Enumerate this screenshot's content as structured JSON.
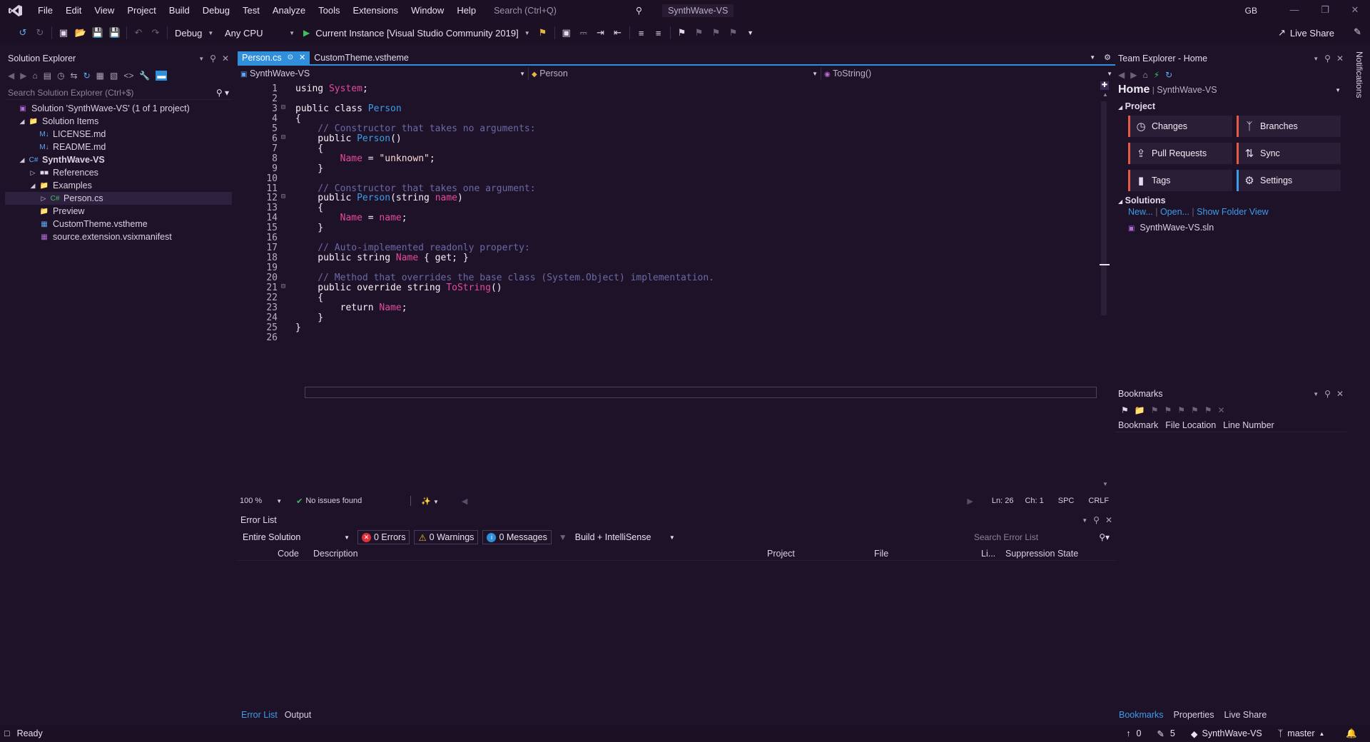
{
  "colors": {
    "background": "#1e1228",
    "accent": "#2f8fdb",
    "keyword": "#f4f1f8",
    "type": "#3d9ce8",
    "comment": "#6a6aa6",
    "identifier": "#e44a9e",
    "string": "#fbdcd8",
    "orange_bar": "#e35a45",
    "blue_bar": "#3d9ce8"
  },
  "menu": [
    "File",
    "Edit",
    "View",
    "Project",
    "Build",
    "Debug",
    "Test",
    "Analyze",
    "Tools",
    "Extensions",
    "Window",
    "Help"
  ],
  "search": {
    "placeholder": "Search (Ctrl+Q)"
  },
  "title": {
    "solution_name": "SynthWave-VS",
    "user_initials": "GB"
  },
  "toolbar": {
    "configuration": "Debug",
    "platform": "Any CPU",
    "run_label": "Current Instance [Visual Studio Community 2019]",
    "live_share": "Live Share"
  },
  "solution_explorer": {
    "title": "Solution Explorer",
    "search_placeholder": "Search Solution Explorer (Ctrl+$)",
    "tree": [
      {
        "label": "Solution 'SynthWave-VS' (1 of 1 project)",
        "icon": "solution-icon",
        "level": 0,
        "twisty": ""
      },
      {
        "label": "Solution Items",
        "icon": "folder-icon",
        "level": 1,
        "twisty": "open"
      },
      {
        "label": "LICENSE.md",
        "icon": "markdown-icon",
        "level": 2,
        "twisty": ""
      },
      {
        "label": "README.md",
        "icon": "markdown-icon",
        "level": 2,
        "twisty": ""
      },
      {
        "label": "SynthWave-VS",
        "icon": "csharp-project-icon",
        "level": 1,
        "twisty": "open",
        "bold": true
      },
      {
        "label": "References",
        "icon": "references-icon",
        "level": 2,
        "twisty": "closed"
      },
      {
        "label": "Examples",
        "icon": "folder-icon",
        "level": 2,
        "twisty": "open"
      },
      {
        "label": "Person.cs",
        "icon": "csharp-file-icon",
        "level": 3,
        "twisty": "closed",
        "selected": true
      },
      {
        "label": "Preview",
        "icon": "folder-icon",
        "level": 2,
        "twisty": ""
      },
      {
        "label": "CustomTheme.vstheme",
        "icon": "vstheme-file-icon",
        "level": 2,
        "twisty": ""
      },
      {
        "label": "source.extension.vsixmanifest",
        "icon": "manifest-file-icon",
        "level": 2,
        "twisty": ""
      }
    ]
  },
  "editor": {
    "tabs": [
      {
        "label": "Person.cs",
        "active": true
      },
      {
        "label": "CustomTheme.vstheme",
        "active": false
      }
    ],
    "nav": {
      "project": "SynthWave-VS",
      "type": "Person",
      "member": "ToString()"
    },
    "status": {
      "zoom": "100 %",
      "issues": "No issues found",
      "line": "Ln: 26",
      "col": "Ch: 1",
      "spacing": "SPC",
      "line_ending": "CRLF"
    }
  },
  "code_lines": [
    [
      {
        "t": "using ",
        "c": "kw"
      },
      {
        "t": "System",
        "c": "ident"
      },
      {
        "t": ";",
        "c": "kw"
      }
    ],
    [],
    [
      {
        "t": "public class ",
        "c": "kw"
      },
      {
        "t": "Person",
        "c": "type"
      }
    ],
    [
      {
        "t": "{",
        "c": "kw"
      }
    ],
    [
      {
        "t": "    // Constructor that takes no arguments:",
        "c": "cmt"
      }
    ],
    [
      {
        "t": "    public ",
        "c": "kw"
      },
      {
        "t": "Person",
        "c": "type"
      },
      {
        "t": "()",
        "c": "kw"
      }
    ],
    [
      {
        "t": "    {",
        "c": "kw"
      }
    ],
    [
      {
        "t": "        ",
        "c": "kw"
      },
      {
        "t": "Name",
        "c": "ident"
      },
      {
        "t": " = ",
        "c": "kw"
      },
      {
        "t": "\"unknown\"",
        "c": "str"
      },
      {
        "t": ";",
        "c": "kw"
      }
    ],
    [
      {
        "t": "    }",
        "c": "kw"
      }
    ],
    [],
    [
      {
        "t": "    // Constructor that takes one argument:",
        "c": "cmt"
      }
    ],
    [
      {
        "t": "    public ",
        "c": "kw"
      },
      {
        "t": "Person",
        "c": "type"
      },
      {
        "t": "(string ",
        "c": "kw"
      },
      {
        "t": "name",
        "c": "ident"
      },
      {
        "t": ")",
        "c": "kw"
      }
    ],
    [
      {
        "t": "    {",
        "c": "kw"
      }
    ],
    [
      {
        "t": "        ",
        "c": "kw"
      },
      {
        "t": "Name",
        "c": "ident"
      },
      {
        "t": " = ",
        "c": "kw"
      },
      {
        "t": "name",
        "c": "ident"
      },
      {
        "t": ";",
        "c": "kw"
      }
    ],
    [
      {
        "t": "    }",
        "c": "kw"
      }
    ],
    [],
    [
      {
        "t": "    // Auto-implemented readonly property:",
        "c": "cmt"
      }
    ],
    [
      {
        "t": "    public string ",
        "c": "kw"
      },
      {
        "t": "Name",
        "c": "ident"
      },
      {
        "t": " { get; }",
        "c": "kw"
      }
    ],
    [],
    [
      {
        "t": "    // Method that overrides the base class (System.Object) implementation.",
        "c": "cmt"
      }
    ],
    [
      {
        "t": "    public override string ",
        "c": "kw"
      },
      {
        "t": "ToString",
        "c": "ident"
      },
      {
        "t": "()",
        "c": "kw"
      }
    ],
    [
      {
        "t": "    {",
        "c": "kw"
      }
    ],
    [
      {
        "t": "        return ",
        "c": "kw"
      },
      {
        "t": "Name",
        "c": "ident"
      },
      {
        "t": ";",
        "c": "kw"
      }
    ],
    [
      {
        "t": "    }",
        "c": "kw"
      }
    ],
    [
      {
        "t": "}",
        "c": "kw"
      }
    ],
    []
  ],
  "error_list": {
    "title": "Error List",
    "scope": "Entire Solution",
    "errors": "0 Errors",
    "warnings": "0 Warnings",
    "messages": "0 Messages",
    "build_filter": "Build + IntelliSense",
    "search_placeholder": "Search Error List",
    "columns": [
      "Code",
      "Description",
      "Project",
      "File",
      "Li...",
      "Suppression State"
    ],
    "bottom_tabs": [
      "Error List",
      "Output"
    ]
  },
  "team_explorer": {
    "title": "Team Explorer - Home",
    "home": "Home",
    "home_sub": "SynthWave-VS",
    "project_section": "Project",
    "buttons": [
      {
        "label": "Changes",
        "icon": "clock-icon",
        "bar": "orange"
      },
      {
        "label": "Branches",
        "icon": "branch-icon",
        "bar": "orange"
      },
      {
        "label": "Pull Requests",
        "icon": "pull-request-icon",
        "bar": "orange"
      },
      {
        "label": "Sync",
        "icon": "sync-icon",
        "bar": "orange"
      },
      {
        "label": "Tags",
        "icon": "tag-icon",
        "bar": "orange"
      },
      {
        "label": "Settings",
        "icon": "gear-icon",
        "bar": "blue"
      }
    ],
    "solutions_section": "Solutions",
    "links": [
      "New...",
      "Open...",
      "Show Folder View"
    ],
    "solution_file": "SynthWave-VS.sln"
  },
  "bookmarks": {
    "title": "Bookmarks",
    "columns": [
      "Bookmark",
      "File Location",
      "Line Number"
    ],
    "bottom_tabs": [
      "Bookmarks",
      "Properties",
      "Live Share"
    ]
  },
  "notifications": "Notifications",
  "statusbar": {
    "ready": "Ready",
    "up_count": "0",
    "pencil_count": "5",
    "repo": "SynthWave-VS",
    "branch": "master"
  }
}
